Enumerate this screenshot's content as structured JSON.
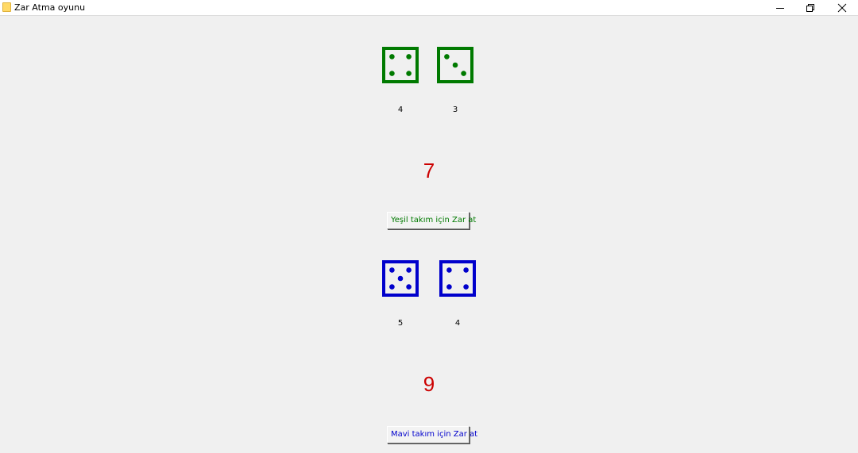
{
  "window": {
    "title": "Zar Atma oyunu"
  },
  "green_team": {
    "color": "#007a00",
    "dice": [
      {
        "value": 4,
        "label": "4"
      },
      {
        "value": 3,
        "label": "3"
      }
    ],
    "total": "7",
    "button_label": "Yeşil takım için Zar at"
  },
  "blue_team": {
    "color": "#0000cc",
    "dice": [
      {
        "value": 5,
        "label": "5"
      },
      {
        "value": 4,
        "label": "4"
      }
    ],
    "total": "9",
    "button_label": "Mavi takım için Zar at"
  },
  "colors": {
    "total_text": "#cc0000",
    "background": "#f0f0f0"
  },
  "icons": [
    "app-icon",
    "minimize-icon",
    "restore-icon",
    "close-icon"
  ]
}
